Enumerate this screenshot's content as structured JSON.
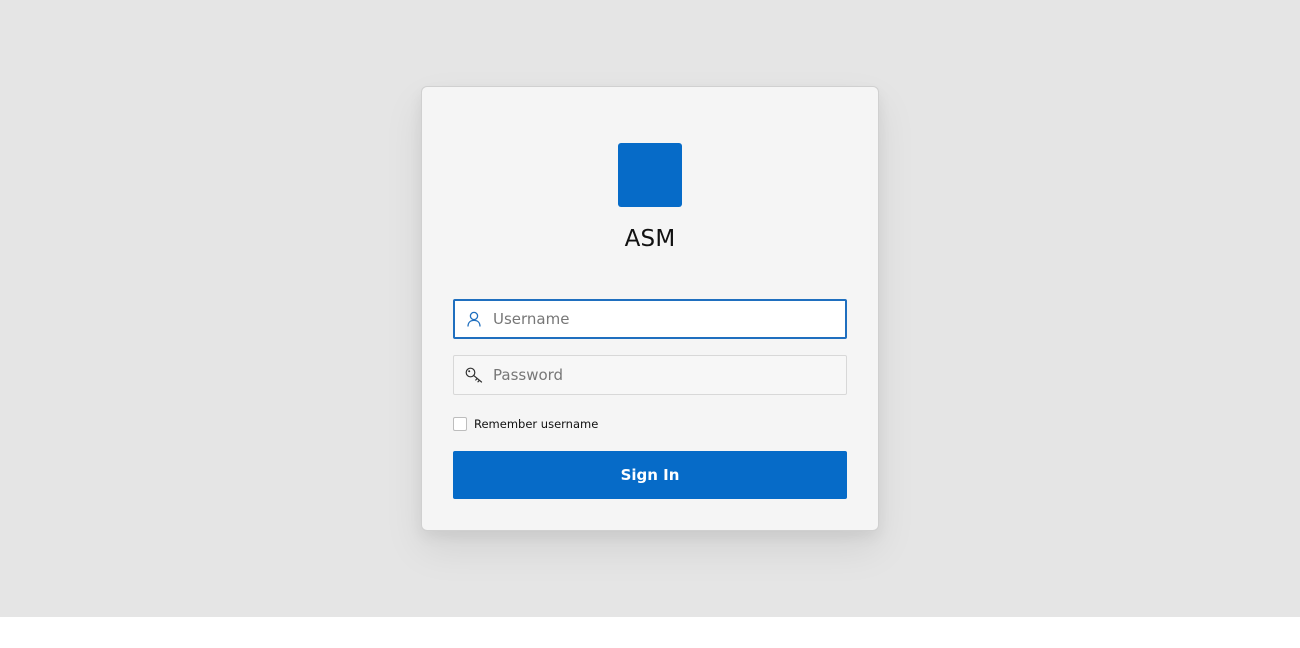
{
  "app": {
    "title": "ASM",
    "brand_color": "#066bc8"
  },
  "login": {
    "username": {
      "placeholder": "Username",
      "value": "",
      "icon": "user-icon",
      "focused": true
    },
    "password": {
      "placeholder": "Password",
      "value": "",
      "icon": "key-icon"
    },
    "remember": {
      "label": "Remember username",
      "checked": false
    },
    "submit_label": "Sign In"
  },
  "colors": {
    "backdrop": "#e5e5e5",
    "card": "#f5f5f5",
    "focus_border": "#1f6fbf",
    "button": "#066bc8"
  }
}
